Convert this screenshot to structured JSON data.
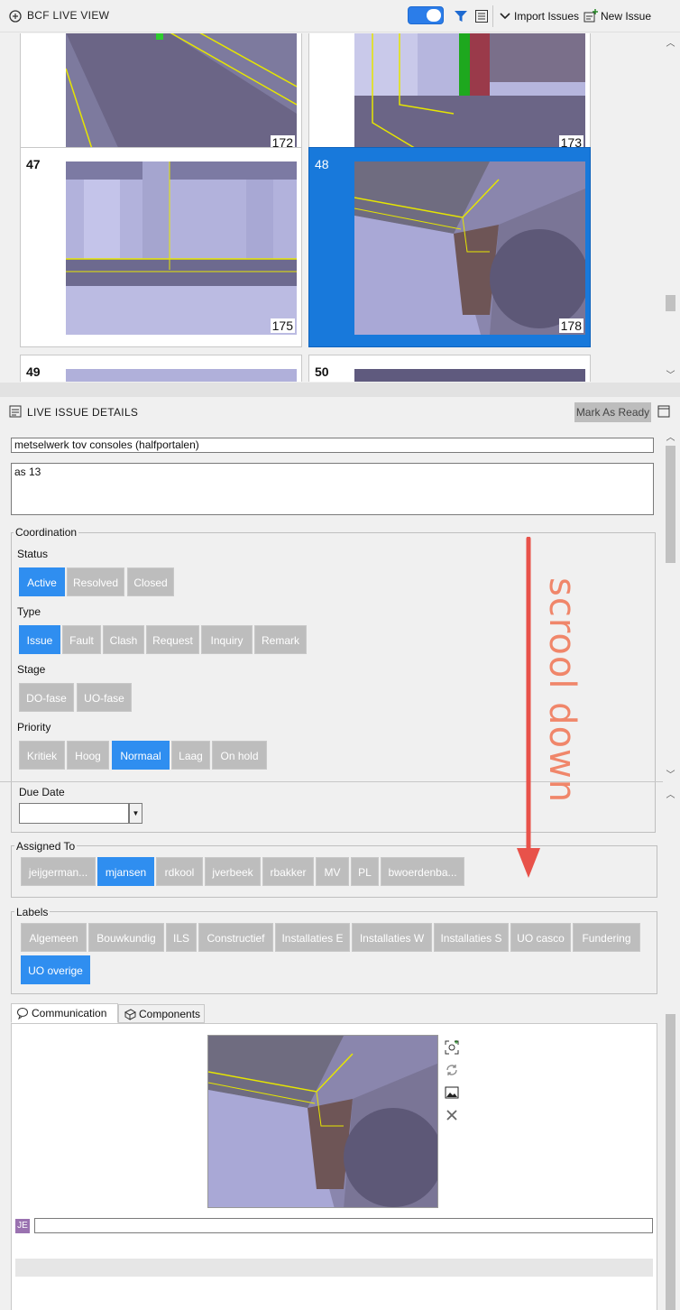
{
  "header": {
    "title": "BCF LIVE VIEW",
    "import_label": "Import Issues",
    "new_label": "New Issue"
  },
  "grid": {
    "tiles": [
      {
        "number": "",
        "thumb_label": "172"
      },
      {
        "number": "",
        "thumb_label": "173"
      },
      {
        "number": "47",
        "thumb_label": "175"
      },
      {
        "number": "48",
        "thumb_label": "178",
        "selected": true
      },
      {
        "number": "49"
      },
      {
        "number": "50"
      }
    ]
  },
  "details": {
    "title": "LIVE ISSUE DETAILS",
    "mark_ready": "Mark As Ready",
    "issue_title": "metselwerk tov consoles (halfportalen)",
    "description": "as 13",
    "coordination_label": "Coordination",
    "status": {
      "label": "Status",
      "options": [
        "Active",
        "Resolved",
        "Closed"
      ],
      "selected": "Active"
    },
    "type": {
      "label": "Type",
      "options": [
        "Issue",
        "Fault",
        "Clash",
        "Request",
        "Inquiry",
        "Remark"
      ],
      "selected": "Issue"
    },
    "stage": {
      "label": "Stage",
      "options": [
        "DO-fase",
        "UO-fase"
      ],
      "selected": ""
    },
    "priority": {
      "label": "Priority",
      "options": [
        "Kritiek",
        "Hoog",
        "Normaal",
        "Laag",
        "On hold"
      ],
      "selected": "Normaal"
    },
    "due_date": {
      "label": "Due Date",
      "value": ""
    },
    "assigned": {
      "label": "Assigned To",
      "options": [
        "jeijgerman...",
        "mjansen",
        "rdkool",
        "jverbeek",
        "rbakker",
        "MV",
        "PL",
        "bwoerdenba..."
      ],
      "selected": "mjansen"
    },
    "labels": {
      "label": "Labels",
      "options": [
        "Algemeen",
        "Bouwkundig",
        "ILS",
        "Constructief",
        "Installaties E",
        "Installaties W",
        "Installaties S",
        "UO casco",
        "Fundering",
        "UO overige"
      ],
      "selected": "UO overige"
    },
    "tabs": {
      "communication": "Communication",
      "components": "Components"
    },
    "comment_avatar": "JE",
    "comment_value": ""
  },
  "annotation": {
    "text": "scrool down",
    "color": "#e8524a",
    "text_color": "#f0866a"
  },
  "colors": {
    "accent": "#2f8ef0",
    "inactive_button": "#bdbdbd"
  }
}
